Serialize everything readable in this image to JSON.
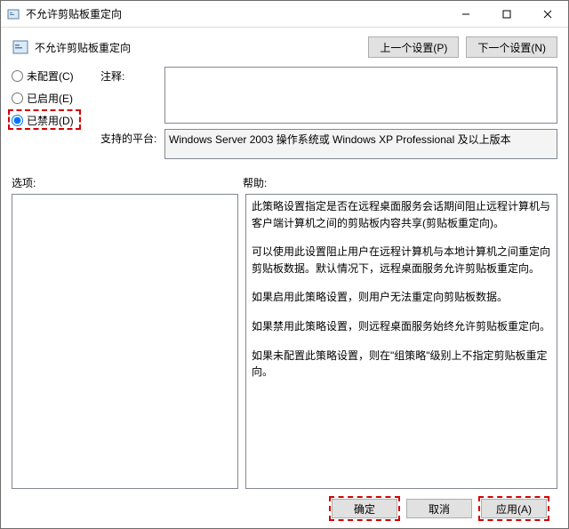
{
  "window": {
    "title": "不允许剪贴板重定向"
  },
  "header": {
    "title": "不允许剪贴板重定向",
    "prev_btn": "上一个设置(P)",
    "next_btn": "下一个设置(N)"
  },
  "radios": {
    "not_configured": "未配置(C)",
    "enabled": "已启用(E)",
    "disabled": "已禁用(D)",
    "selected": "disabled"
  },
  "fields": {
    "comment_label": "注释:",
    "comment_value": "",
    "platform_label": "支持的平台:",
    "platform_value": "Windows Server 2003 操作系统或 Windows XP Professional 及以上版本"
  },
  "lower": {
    "options_label": "选项:",
    "help_label": "帮助:",
    "help_paragraphs": [
      "此策略设置指定是否在远程桌面服务会话期间阻止远程计算机与客户端计算机之间的剪贴板内容共享(剪贴板重定向)。",
      "可以使用此设置阻止用户在远程计算机与本地计算机之间重定向剪贴板数据。默认情况下，远程桌面服务允许剪贴板重定向。",
      "如果启用此策略设置，则用户无法重定向剪贴板数据。",
      "如果禁用此策略设置，则远程桌面服务始终允许剪贴板重定向。",
      "如果未配置此策略设置，则在\"组策略\"级别上不指定剪贴板重定向。"
    ]
  },
  "footer": {
    "ok": "确定",
    "cancel": "取消",
    "apply": "应用(A)"
  }
}
